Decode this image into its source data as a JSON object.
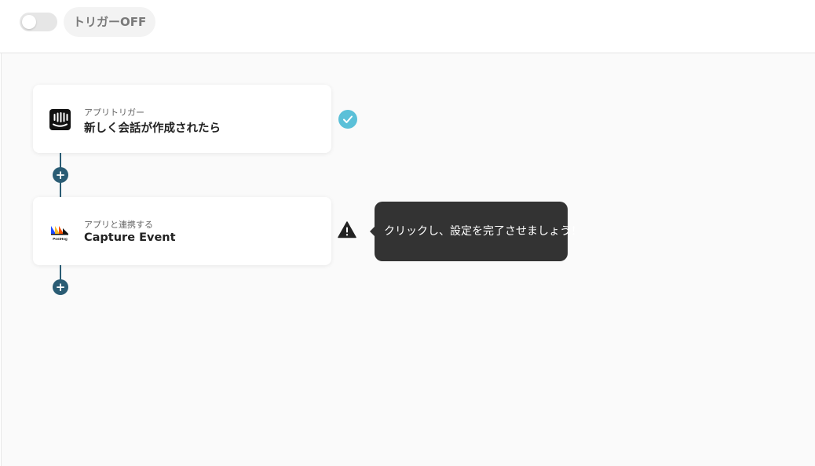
{
  "header": {
    "trigger_status": "トリガーOFF",
    "toggle_on": false
  },
  "flow": {
    "steps": [
      {
        "subtitle": "アプリトリガー",
        "title": "新しく会話が作成されたら",
        "app_icon": "intercom-logo-icon",
        "status": "complete",
        "status_icon": "check-circle-icon"
      },
      {
        "subtitle": "アプリと連携する",
        "title": "Capture Event",
        "app_icon": "posthog-logo-icon",
        "status": "incomplete",
        "status_icon": "warning-icon"
      }
    ],
    "tooltip": "クリックし、設定を完了させましょう！"
  },
  "colors": {
    "connector": "#2a5c74",
    "status_ok": "#5bc0d8",
    "tooltip_bg": "#333333",
    "canvas_bg": "#fafafa"
  }
}
